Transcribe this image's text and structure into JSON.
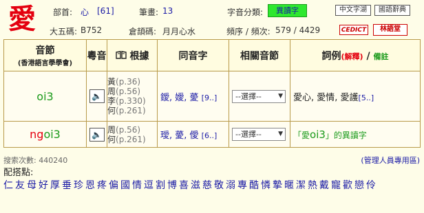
{
  "header": {
    "char": "愛",
    "radical_label": "部首:",
    "radical": "心",
    "radical_num": "[61]",
    "strokes_label": "筆畫:",
    "strokes": "13",
    "category_label": "字音分類:",
    "category": "異讀字",
    "big5_label": "大五碼:",
    "big5": "B752",
    "cangjie_label": "倉頡碼:",
    "cangjie": "月月心水",
    "freq_label": "頻序 / 頻次:",
    "freq": "579 / 4429",
    "btn_zhongwen": "中文字湖",
    "btn_guoyu": "國語辭典",
    "btn_cedict": "CEDICT",
    "btn_lin": "林語堂"
  },
  "table": {
    "headers": {
      "syllable": "音節",
      "syllable_sub": "(香港語言學學會)",
      "sound": "粵音",
      "basis": "根據",
      "homophones": "同音字",
      "related": "相關音節",
      "examples": "詞例",
      "examples_exp": "(解釋)",
      "examples_sep": " / ",
      "examples_note": "備註"
    },
    "rows": [
      {
        "syllable": "oi3",
        "refs": [
          {
            "name": "黃",
            "page": "(p.36)"
          },
          {
            "name": "周",
            "page": "(p.56)"
          },
          {
            "name": "李",
            "page": "(p.330)"
          },
          {
            "name": "何",
            "page": "(p.261)"
          }
        ],
        "homophones": "鑀, 嬡, 薆",
        "homophones_count": "[9..]",
        "select": "--選擇--",
        "words": "愛心, 愛情, 愛護",
        "words_count": "[5..]"
      },
      {
        "syllable_initial": "ng",
        "syllable_rest": "oi3",
        "refs": [
          {
            "name": "周",
            "page": "(p.56)"
          },
          {
            "name": "何",
            "page": "(p.261)"
          }
        ],
        "homophones": "璦, 薆, 僾",
        "homophones_count": "[6..]",
        "select": "--選擇--",
        "variant_pre": "「愛",
        "variant_syl": "oi3",
        "variant_post": "」的異讀字"
      }
    ]
  },
  "footer": {
    "stats": "搜索次數: 440240",
    "admin": "(管理人員專用區)",
    "collocation_label": "配搭點:",
    "collocations": [
      "仁",
      "友",
      "母",
      "好",
      "厚",
      "垂",
      "珍",
      "恩",
      "疼",
      "偏",
      "國",
      "情",
      "逗",
      "割",
      "博",
      "喜",
      "滋",
      "慈",
      "敬",
      "溺",
      "專",
      "酷",
      "憐",
      "摯",
      "暱",
      "潔",
      "熱",
      "戴",
      "寵",
      "歡",
      "戀",
      "伶"
    ]
  }
}
